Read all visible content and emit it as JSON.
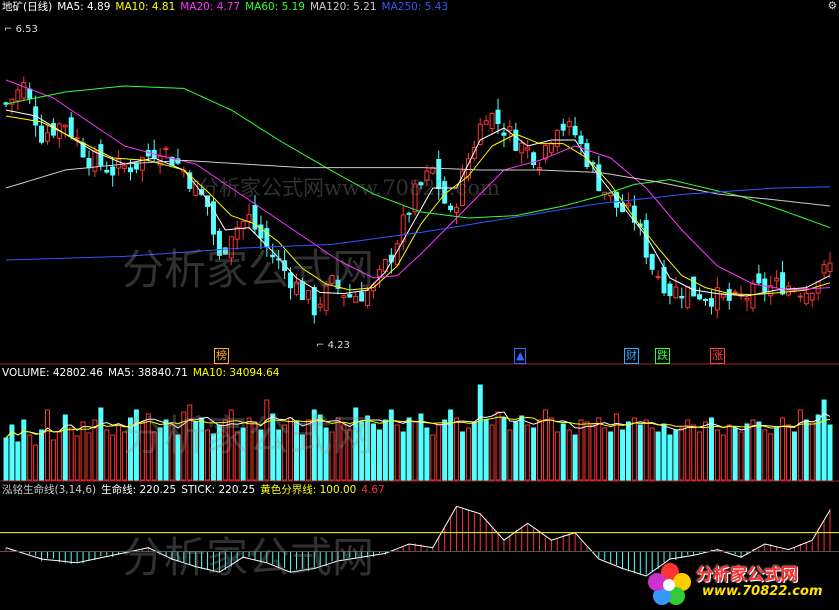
{
  "main_legend": {
    "title": "地矿(日线)",
    "items": [
      {
        "label": "MA5: 4.89",
        "color": "#ffffff"
      },
      {
        "label": "MA10: 4.81",
        "color": "#ffff00"
      },
      {
        "label": "MA20: 4.77",
        "color": "#ff33ff"
      },
      {
        "label": "MA60: 5.19",
        "color": "#33ff33"
      },
      {
        "label": "MA120: 5.21",
        "color": "#cccccc"
      },
      {
        "label": "MA250: 5.43",
        "color": "#3355ff"
      }
    ]
  },
  "corner_icon": "gear-icon",
  "volume_legend": {
    "items": [
      {
        "label": "VOLUME: 42802.46",
        "color": "#ffffff"
      },
      {
        "label": "MA5: 38840.71",
        "color": "#ffffff"
      },
      {
        "label": "MA10: 34094.64",
        "color": "#ffff00"
      }
    ]
  },
  "indicator_legend": {
    "items": [
      {
        "label": "泓铭生命线(3,14,6)",
        "color": "#cccccc"
      },
      {
        "label": "生命线: 220.25",
        "color": "#ffffff"
      },
      {
        "label": "STICK: 220.25",
        "color": "#ffffff"
      },
      {
        "label": "黄色分界线: 100.00",
        "color": "#ffff00"
      },
      {
        "label": "4.67",
        "color": "#ff3333"
      }
    ]
  },
  "labels": {
    "high": "6.53",
    "low": "4.23"
  },
  "event_markers": [
    {
      "text": "榜",
      "color": "#ffaa33"
    },
    {
      "text": "▲",
      "color": "#3366ff"
    },
    {
      "text": "财",
      "color": "#33aaff"
    },
    {
      "text": "跌",
      "color": "#33ff33"
    },
    {
      "text": "涨",
      "color": "#ff4444"
    }
  ],
  "watermarks": [
    "分析家公式网www.70822.com",
    "分析家公式网",
    "分析家公式网",
    "分析家公式网"
  ],
  "logo": {
    "name": "分析家公式网",
    "url": "www.70822.com",
    "icon": "flower-logo-icon"
  },
  "colors": {
    "up": "#ff3333",
    "down": "#55ffff",
    "ma5": "#ffffff",
    "ma10": "#ffff00",
    "ma20": "#ff33ff",
    "ma60": "#33ff33",
    "ma120": "#cccccc",
    "ma250": "#3355ff"
  },
  "chart_data": [
    {
      "type": "candlestick",
      "title": "地矿(日线)",
      "ylim": [
        4.0,
        6.8
      ],
      "count": 140,
      "high_marker": 6.53,
      "low_marker": 4.23,
      "close_path": [
        [
          0,
          6.05
        ],
        [
          3,
          6.2
        ],
        [
          6,
          5.8
        ],
        [
          10,
          5.9
        ],
        [
          14,
          5.6
        ],
        [
          18,
          5.5
        ],
        [
          22,
          5.55
        ],
        [
          26,
          5.7
        ],
        [
          30,
          5.5
        ],
        [
          34,
          5.2
        ],
        [
          36,
          4.75
        ],
        [
          38,
          5.0
        ],
        [
          41,
          5.1
        ],
        [
          44,
          4.85
        ],
        [
          48,
          4.6
        ],
        [
          52,
          4.35
        ],
        [
          55,
          4.55
        ],
        [
          58,
          4.45
        ],
        [
          62,
          4.5
        ],
        [
          65,
          4.8
        ],
        [
          69,
          5.3
        ],
        [
          72,
          5.5
        ],
        [
          75,
          5.1
        ],
        [
          78,
          5.6
        ],
        [
          81,
          6.0
        ],
        [
          84,
          5.85
        ],
        [
          87,
          5.7
        ],
        [
          90,
          5.6
        ],
        [
          93,
          5.9
        ],
        [
          96,
          5.8
        ],
        [
          100,
          5.4
        ],
        [
          103,
          5.2
        ],
        [
          106,
          5.1
        ],
        [
          109,
          4.7
        ],
        [
          112,
          4.5
        ],
        [
          115,
          4.5
        ],
        [
          119,
          4.45
        ],
        [
          123,
          4.4
        ],
        [
          127,
          4.5
        ],
        [
          131,
          4.55
        ],
        [
          135,
          4.5
        ],
        [
          139,
          4.7
        ]
      ],
      "ma_lines": [
        {
          "name": "MA5",
          "path": [
            [
              0,
              6.0
            ],
            [
              5,
              5.95
            ],
            [
              10,
              5.8
            ],
            [
              15,
              5.65
            ],
            [
              20,
              5.55
            ],
            [
              25,
              5.6
            ],
            [
              30,
              5.5
            ],
            [
              34,
              5.25
            ],
            [
              37,
              5.0
            ],
            [
              41,
              5.02
            ],
            [
              45,
              4.82
            ],
            [
              49,
              4.6
            ],
            [
              53,
              4.48
            ],
            [
              57,
              4.47
            ],
            [
              61,
              4.5
            ],
            [
              64,
              4.65
            ],
            [
              68,
              5.0
            ],
            [
              72,
              5.35
            ],
            [
              76,
              5.35
            ],
            [
              80,
              5.75
            ],
            [
              84,
              5.85
            ],
            [
              88,
              5.7
            ],
            [
              92,
              5.75
            ],
            [
              96,
              5.75
            ],
            [
              100,
              5.45
            ],
            [
              104,
              5.2
            ],
            [
              108,
              4.95
            ],
            [
              112,
              4.6
            ],
            [
              116,
              4.5
            ],
            [
              120,
              4.47
            ],
            [
              125,
              4.45
            ],
            [
              130,
              4.5
            ],
            [
              135,
              4.52
            ],
            [
              139,
              4.62
            ]
          ]
        },
        {
          "name": "MA10",
          "path": [
            [
              0,
              5.95
            ],
            [
              6,
              5.9
            ],
            [
              12,
              5.75
            ],
            [
              18,
              5.6
            ],
            [
              24,
              5.58
            ],
            [
              30,
              5.5
            ],
            [
              34,
              5.32
            ],
            [
              38,
              5.12
            ],
            [
              42,
              5.05
            ],
            [
              46,
              4.9
            ],
            [
              50,
              4.68
            ],
            [
              54,
              4.55
            ],
            [
              58,
              4.5
            ],
            [
              62,
              4.52
            ],
            [
              66,
              4.7
            ],
            [
              70,
              5.05
            ],
            [
              74,
              5.3
            ],
            [
              78,
              5.45
            ],
            [
              82,
              5.7
            ],
            [
              86,
              5.8
            ],
            [
              90,
              5.72
            ],
            [
              94,
              5.72
            ],
            [
              98,
              5.6
            ],
            [
              102,
              5.38
            ],
            [
              106,
              5.1
            ],
            [
              110,
              4.85
            ],
            [
              114,
              4.62
            ],
            [
              118,
              4.52
            ],
            [
              122,
              4.47
            ],
            [
              126,
              4.46
            ],
            [
              131,
              4.48
            ],
            [
              135,
              4.5
            ],
            [
              139,
              4.56
            ]
          ]
        },
        {
          "name": "MA20",
          "path": [
            [
              0,
              6.25
            ],
            [
              8,
              6.1
            ],
            [
              14,
              5.9
            ],
            [
              20,
              5.7
            ],
            [
              26,
              5.62
            ],
            [
              32,
              5.55
            ],
            [
              38,
              5.35
            ],
            [
              44,
              5.15
            ],
            [
              50,
              4.95
            ],
            [
              56,
              4.75
            ],
            [
              62,
              4.6
            ],
            [
              66,
              4.62
            ],
            [
              70,
              4.8
            ],
            [
              74,
              5.0
            ],
            [
              78,
              5.2
            ],
            [
              84,
              5.5
            ],
            [
              90,
              5.58
            ],
            [
              96,
              5.7
            ],
            [
              102,
              5.6
            ],
            [
              108,
              5.35
            ],
            [
              114,
              5.0
            ],
            [
              120,
              4.7
            ],
            [
              126,
              4.55
            ],
            [
              132,
              4.5
            ],
            [
              139,
              4.52
            ]
          ]
        },
        {
          "name": "MA60",
          "path": [
            [
              0,
              6.05
            ],
            [
              10,
              6.15
            ],
            [
              20,
              6.2
            ],
            [
              30,
              6.18
            ],
            [
              38,
              6.0
            ],
            [
              46,
              5.75
            ],
            [
              54,
              5.52
            ],
            [
              62,
              5.3
            ],
            [
              70,
              5.15
            ],
            [
              78,
              5.1
            ],
            [
              86,
              5.12
            ],
            [
              94,
              5.2
            ],
            [
              100,
              5.28
            ],
            [
              106,
              5.38
            ],
            [
              112,
              5.42
            ],
            [
              118,
              5.35
            ],
            [
              124,
              5.28
            ],
            [
              130,
              5.18
            ],
            [
              139,
              5.02
            ]
          ]
        },
        {
          "name": "MA120",
          "path": [
            [
              0,
              5.35
            ],
            [
              10,
              5.5
            ],
            [
              20,
              5.55
            ],
            [
              30,
              5.58
            ],
            [
              40,
              5.55
            ],
            [
              50,
              5.52
            ],
            [
              60,
              5.52
            ],
            [
              70,
              5.52
            ],
            [
              80,
              5.5
            ],
            [
              90,
              5.5
            ],
            [
              100,
              5.48
            ],
            [
              110,
              5.4
            ],
            [
              120,
              5.3
            ],
            [
              130,
              5.25
            ],
            [
              139,
              5.2
            ]
          ]
        },
        {
          "name": "MA250",
          "path": [
            [
              0,
              4.75
            ],
            [
              20,
              4.78
            ],
            [
              40,
              4.85
            ],
            [
              55,
              4.88
            ],
            [
              70,
              4.98
            ],
            [
              85,
              5.1
            ],
            [
              100,
              5.22
            ],
            [
              115,
              5.3
            ],
            [
              130,
              5.35
            ],
            [
              139,
              5.36
            ]
          ]
        }
      ]
    },
    {
      "type": "bar",
      "title": "VOLUME",
      "ylim": [
        0,
        100000
      ],
      "values_note_none": "",
      "volume_seed": [
        42,
        55,
        38,
        60,
        45,
        35,
        50,
        70,
        40,
        48,
        65,
        52,
        44,
        58,
        47,
        60,
        72,
        50,
        45,
        55,
        48,
        62,
        70,
        58,
        66,
        48,
        52,
        60,
        55,
        45,
        68,
        75,
        58,
        62,
        50,
        46,
        55,
        60,
        70,
        48,
        52,
        62,
        58,
        50,
        80,
        66,
        50,
        55,
        62,
        58,
        45,
        60,
        70,
        65,
        52,
        48,
        62,
        55,
        50,
        72,
        58,
        64,
        56,
        50,
        60,
        70,
        55,
        48,
        62,
        58,
        66,
        52,
        45,
        55,
        60,
        70,
        62,
        48,
        52,
        58,
        95,
        60,
        55,
        68,
        62,
        50,
        58,
        64,
        55,
        52,
        60,
        70,
        62,
        48,
        56,
        50,
        45,
        60,
        58,
        55,
        62,
        52,
        48,
        66,
        50,
        58,
        62,
        55,
        60,
        52,
        48,
        56,
        45,
        50,
        52,
        60,
        55,
        48,
        58,
        62,
        50,
        45,
        55,
        52,
        48,
        56,
        60,
        58,
        50,
        46,
        52,
        62,
        55,
        48,
        70,
        60,
        58,
        65,
        80,
        55
      ],
      "series": [
        {
          "name": "MA5",
          "values": []
        },
        {
          "name": "MA10",
          "values": []
        }
      ]
    },
    {
      "type": "bar",
      "title": "泓铭生命线(3,14,6)",
      "ylim": [
        -300,
        300
      ],
      "stick_path": [
        [
          0,
          20
        ],
        [
          6,
          -40
        ],
        [
          12,
          -60
        ],
        [
          18,
          -20
        ],
        [
          24,
          20
        ],
        [
          28,
          -40
        ],
        [
          32,
          -80
        ],
        [
          36,
          -110
        ],
        [
          40,
          -30
        ],
        [
          44,
          -60
        ],
        [
          48,
          -110
        ],
        [
          52,
          -90
        ],
        [
          56,
          -50
        ],
        [
          60,
          -30
        ],
        [
          64,
          -10
        ],
        [
          68,
          40
        ],
        [
          72,
          20
        ],
        [
          76,
          240
        ],
        [
          80,
          200
        ],
        [
          84,
          60
        ],
        [
          88,
          150
        ],
        [
          92,
          60
        ],
        [
          96,
          100
        ],
        [
          100,
          -40
        ],
        [
          104,
          -90
        ],
        [
          108,
          -130
        ],
        [
          112,
          -40
        ],
        [
          116,
          -20
        ],
        [
          120,
          10
        ],
        [
          124,
          -30
        ],
        [
          128,
          40
        ],
        [
          132,
          10
        ],
        [
          136,
          60
        ],
        [
          139,
          220
        ]
      ],
      "divider": 100
    }
  ]
}
